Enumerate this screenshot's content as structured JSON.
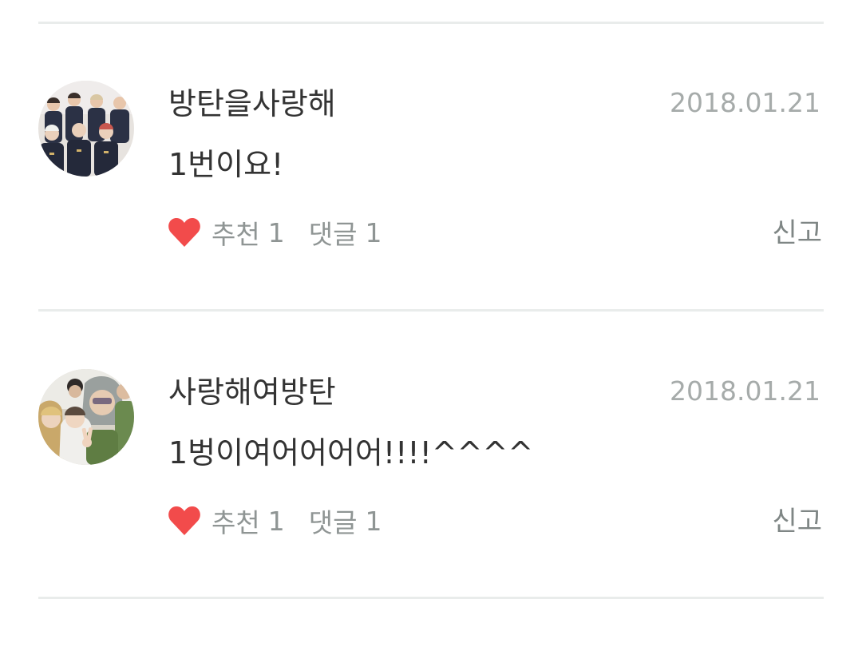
{
  "comments": [
    {
      "author": "방탄을사랑해",
      "date": "2018.01.21",
      "text": "1번이요!",
      "like_label": "추천",
      "like_count": "1",
      "reply_label": "댓글",
      "reply_count": "1",
      "report_label": "신고"
    },
    {
      "author": "사랑해여방탄",
      "date": "2018.01.21",
      "text": "1벙이여어어어어!!!!^^^^",
      "like_label": "추천",
      "like_count": "1",
      "reply_label": "댓글",
      "reply_count": "1",
      "report_label": "신고"
    }
  ],
  "colors": {
    "heart": "#f24b4b",
    "divider": "#e9eceb",
    "date": "#a6abaa",
    "text": "#333333"
  },
  "icons": {
    "like": "heart-icon"
  }
}
